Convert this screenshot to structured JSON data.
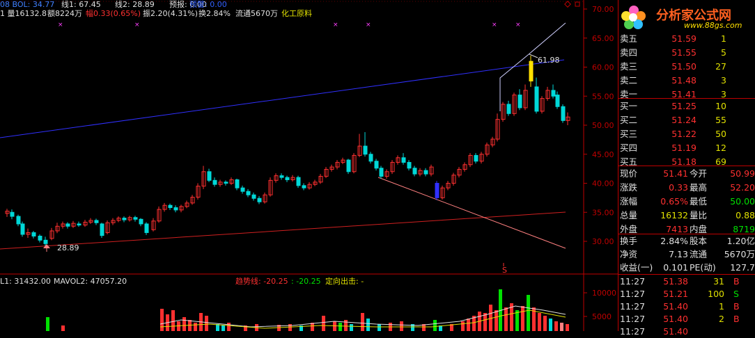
{
  "header": {
    "line1": [
      {
        "text": "08 BOL: 34.77",
        "color": "#4080ff"
      },
      {
        "text": "线1: 67.45",
        "color": "#e0e0e0"
      },
      {
        "text": "线2: 28.89",
        "color": "#e0e0e0"
      },
      {
        "text": "预报: 0.00",
        "color": "#e0e0e0"
      },
      {
        "text": "预警: 0.00",
        "color": "#3060ff"
      }
    ],
    "line2": [
      {
        "text": "1 量16132.8",
        "color": "#e0e0e0"
      },
      {
        "text": "额8224万",
        "color": "#e0e0e0"
      },
      {
        "text": "幅0.33(0.65%)",
        "color": "#ff3030"
      },
      {
        "text": "振2.20(4.31%)",
        "color": "#e0e0e0"
      },
      {
        "text": "换2.84%",
        "color": "#e0e0e0"
      },
      {
        "text": "流通5670万",
        "color": "#e0e0e0"
      },
      {
        "text": "化工原料",
        "color": "#e0e000"
      }
    ]
  },
  "price_axis": [
    "70.00",
    "65.00",
    "60.00",
    "55.00",
    "50.00",
    "45.00",
    "40.00",
    "35.00",
    "30.00"
  ],
  "volume_axis": [
    "10000",
    "5000"
  ],
  "annotations": {
    "high": "61.98",
    "low": "28.89",
    "s_marker": "S"
  },
  "volume_header": [
    {
      "text": "L1: 31432.00",
      "color": "#e0e0e0"
    },
    {
      "text": "MAVOL2: 47057.20",
      "color": "#e0e0e0"
    },
    {
      "text": "趋势线: -20.25",
      "color": "#ff3030"
    },
    {
      "text": ": -20.25",
      "color": "#00e000"
    },
    {
      "text": "定向出击: -",
      "color": "#e0e000"
    }
  ],
  "logo": {
    "title": "分析家公式网",
    "url": "www.88gs.com"
  },
  "order_book": {
    "asks": [
      {
        "label": "卖五",
        "price": "51.59",
        "vol": "1"
      },
      {
        "label": "卖四",
        "price": "51.55",
        "vol": "5"
      },
      {
        "label": "卖三",
        "price": "51.50",
        "vol": "27"
      },
      {
        "label": "卖二",
        "price": "51.48",
        "vol": "3"
      },
      {
        "label": "卖一",
        "price": "51.41",
        "vol": "3"
      }
    ],
    "bids": [
      {
        "label": "买一",
        "price": "51.25",
        "vol": "10"
      },
      {
        "label": "买二",
        "price": "51.24",
        "vol": "55"
      },
      {
        "label": "买三",
        "price": "51.22",
        "vol": "50"
      },
      {
        "label": "买四",
        "price": "51.19",
        "vol": "12"
      },
      {
        "label": "买五",
        "price": "51.18",
        "vol": "69"
      }
    ]
  },
  "quote": [
    {
      "l1": "现价",
      "v1": "51.41",
      "c1": "#ff3030",
      "l2": "今开",
      "v2": "50.99",
      "c2": "#ff3030"
    },
    {
      "l1": "涨跌",
      "v1": "0.33",
      "c1": "#ff3030",
      "l2": "最高",
      "v2": "52.20",
      "c2": "#ff3030"
    },
    {
      "l1": "涨幅",
      "v1": "0.65%",
      "c1": "#ff3030",
      "l2": "最低",
      "v2": "50.00",
      "c2": "#00e000"
    },
    {
      "l1": "总量",
      "v1": "16132",
      "c1": "#e0e000",
      "l2": "量比",
      "v2": "0.88",
      "c2": "#e0e000"
    },
    {
      "l1": "外盘",
      "v1": "7413",
      "c1": "#ff3030",
      "l2": "内盘",
      "v2": "8719",
      "c2": "#00e000"
    }
  ],
  "stats": [
    {
      "l1": "换手",
      "v1": "2.84%",
      "l2": "股本",
      "v2": "1.20亿"
    },
    {
      "l1": "净资",
      "v1": "7.13",
      "l2": "流通",
      "v2": "5670万"
    },
    {
      "l1": "收益(一)",
      "v1": "0.101",
      "l2": "PE(动)",
      "v2": "127.7"
    }
  ],
  "ticks": [
    {
      "time": "11:27",
      "price": "51.38",
      "vol": "31",
      "side": "B",
      "color": "#ff3030"
    },
    {
      "time": "11:27",
      "price": "51.21",
      "vol": "100",
      "side": "S",
      "color": "#00e000"
    },
    {
      "time": "11:27",
      "price": "51.40",
      "vol": "1",
      "side": "B",
      "color": "#ff3030"
    },
    {
      "time": "11:27",
      "price": "51.40",
      "vol": "2",
      "side": "B",
      "color": "#ff3030"
    },
    {
      "time": "11:27",
      "price": "51.40",
      "vol": "",
      "side": "",
      "color": "#ff3030"
    }
  ],
  "colors": {
    "up": "#ff3030",
    "down": "#00d8d8",
    "grid": "#c00000",
    "bol": "#3030ff",
    "trend_red": "#d02020",
    "trend_pink": "#ff8080"
  }
}
